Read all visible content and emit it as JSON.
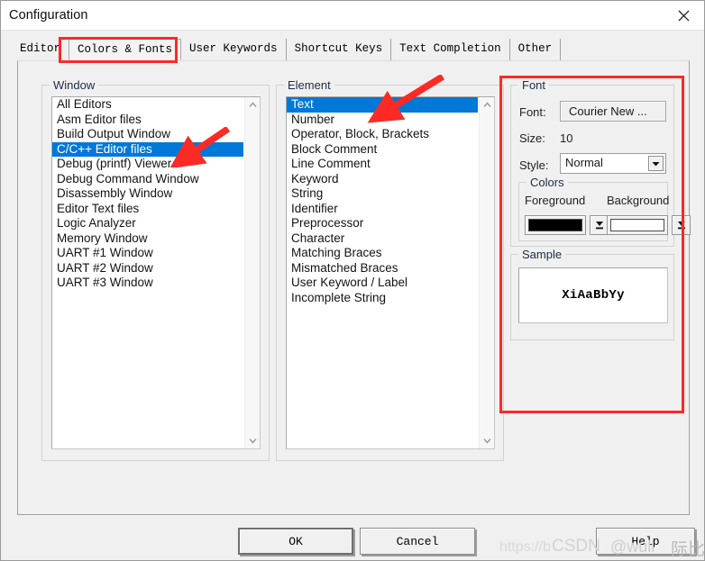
{
  "window": {
    "title": "Configuration",
    "close_icon": "close-icon"
  },
  "tabs": [
    {
      "label": "Editor",
      "selected": false
    },
    {
      "label": "Colors & Fonts",
      "selected": true
    },
    {
      "label": "User Keywords",
      "selected": false
    },
    {
      "label": "Shortcut Keys",
      "selected": false
    },
    {
      "label": "Text Completion",
      "selected": false
    },
    {
      "label": "Other",
      "selected": false
    }
  ],
  "window_group": {
    "title": "Window",
    "items": [
      "All Editors",
      "Asm Editor files",
      "Build Output Window",
      "C/C++ Editor files",
      "Debug (printf) Viewer",
      "Debug Command Window",
      "Disassembly Window",
      "Editor Text files",
      "Logic Analyzer",
      "Memory Window",
      "UART #1 Window",
      "UART #2 Window",
      "UART #3 Window"
    ],
    "selected_index": 3,
    "scroll_up_icon": "chevron-up-icon",
    "scroll_down_icon": "chevron-down-icon"
  },
  "element_group": {
    "title": "Element",
    "items": [
      "Text",
      "Number",
      "Operator, Block, Brackets",
      "Block Comment",
      "Line Comment",
      "Keyword",
      "String",
      "Identifier",
      "Preprocessor",
      "Character",
      "Matching Braces",
      "Mismatched Braces",
      "User Keyword / Label",
      "Incomplete String"
    ],
    "selected_index": 0,
    "scroll_up_icon": "chevron-up-icon",
    "scroll_down_icon": "chevron-down-icon"
  },
  "font_group": {
    "title": "Font",
    "font_label": "Font:",
    "font_value": "Courier New ...",
    "size_label": "Size:",
    "size_value": "10",
    "style_label": "Style:",
    "style_value": "Normal",
    "style_dropdown_icon": "chevron-down-icon"
  },
  "colors_group": {
    "title": "Colors",
    "foreground_label": "Foreground",
    "background_label": "Background",
    "foreground_color": "#000000",
    "background_color": "#ffffff",
    "dropdown_icon": "color-dropdown-icon"
  },
  "sample_group": {
    "title": "Sample",
    "text": "XiAaBbYy"
  },
  "buttons": {
    "ok": "OK",
    "cancel": "Cancel",
    "help": "Help"
  },
  "watermark": {
    "url": "https://b",
    "brand": "CSDN",
    "user": "@wull",
    "cn": "际比白"
  },
  "annotations": {
    "accent_color": "#fc2a25",
    "arrow_tab_label": "colors-fonts-tab-highlight",
    "arrow_window_label": "window-list-selection-arrow",
    "arrow_element_label": "element-list-selection-arrow",
    "box_font_label": "font-panel-highlight"
  }
}
